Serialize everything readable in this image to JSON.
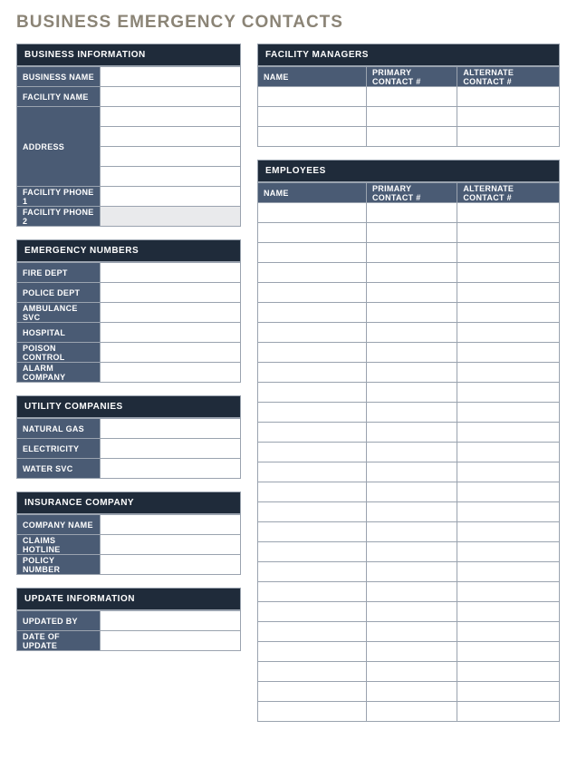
{
  "title": "BUSINESS EMERGENCY CONTACTS",
  "sections": {
    "business_info": {
      "header": "BUSINESS INFORMATION",
      "rows": {
        "business_name": "BUSINESS NAME",
        "facility_name": "FACILITY NAME",
        "address": "ADDRESS",
        "facility_phone1": "FACILITY PHONE 1",
        "facility_phone2": "FACILITY PHONE 2"
      },
      "values": {
        "business_name": "",
        "facility_name": "",
        "address1": "",
        "address2": "",
        "address3": "",
        "address4": "",
        "facility_phone1": "",
        "facility_phone2": ""
      }
    },
    "emergency_numbers": {
      "header": "EMERGENCY NUMBERS",
      "rows": {
        "fire": "FIRE DEPT",
        "police": "POLICE DEPT",
        "ambulance": "AMBULANCE SVC",
        "hospital": "HOSPITAL",
        "poison": "POISON CONTROL",
        "alarm": "ALARM COMPANY"
      },
      "values": {
        "fire": "",
        "police": "",
        "ambulance": "",
        "hospital": "",
        "poison": "",
        "alarm": ""
      }
    },
    "utility": {
      "header": "UTILITY COMPANIES",
      "rows": {
        "gas": "NATURAL GAS",
        "electricity": "ELECTRICITY",
        "water": "WATER SVC"
      },
      "values": {
        "gas": "",
        "electricity": "",
        "water": ""
      }
    },
    "insurance": {
      "header": "INSURANCE COMPANY",
      "rows": {
        "company": "COMPANY NAME",
        "claims": "CLAIMS HOTLINE",
        "policy": "POLICY NUMBER"
      },
      "values": {
        "company": "",
        "claims": "",
        "policy": ""
      }
    },
    "update": {
      "header": "UPDATE INFORMATION",
      "rows": {
        "updated_by": "UPDATED BY",
        "date": "DATE OF UPDATE"
      },
      "values": {
        "updated_by": "",
        "date": ""
      }
    },
    "facility_managers": {
      "header": "FACILITY MANAGERS",
      "cols": {
        "name": "NAME",
        "primary": "PRIMARY CONTACT #",
        "alternate": "ALTERNATE CONTACT #"
      },
      "rows": [
        {
          "name": "",
          "primary": "",
          "alternate": ""
        },
        {
          "name": "",
          "primary": "",
          "alternate": ""
        },
        {
          "name": "",
          "primary": "",
          "alternate": ""
        }
      ]
    },
    "employees": {
      "header": "EMPLOYEES",
      "cols": {
        "name": "NAME",
        "primary": "PRIMARY CONTACT #",
        "alternate": "ALTERNATE CONTACT #"
      },
      "rows": [
        {
          "name": "",
          "primary": "",
          "alternate": ""
        },
        {
          "name": "",
          "primary": "",
          "alternate": ""
        },
        {
          "name": "",
          "primary": "",
          "alternate": ""
        },
        {
          "name": "",
          "primary": "",
          "alternate": ""
        },
        {
          "name": "",
          "primary": "",
          "alternate": ""
        },
        {
          "name": "",
          "primary": "",
          "alternate": ""
        },
        {
          "name": "",
          "primary": "",
          "alternate": ""
        },
        {
          "name": "",
          "primary": "",
          "alternate": ""
        },
        {
          "name": "",
          "primary": "",
          "alternate": ""
        },
        {
          "name": "",
          "primary": "",
          "alternate": ""
        },
        {
          "name": "",
          "primary": "",
          "alternate": ""
        },
        {
          "name": "",
          "primary": "",
          "alternate": ""
        },
        {
          "name": "",
          "primary": "",
          "alternate": ""
        },
        {
          "name": "",
          "primary": "",
          "alternate": ""
        },
        {
          "name": "",
          "primary": "",
          "alternate": ""
        },
        {
          "name": "",
          "primary": "",
          "alternate": ""
        },
        {
          "name": "",
          "primary": "",
          "alternate": ""
        },
        {
          "name": "",
          "primary": "",
          "alternate": ""
        },
        {
          "name": "",
          "primary": "",
          "alternate": ""
        },
        {
          "name": "",
          "primary": "",
          "alternate": ""
        },
        {
          "name": "",
          "primary": "",
          "alternate": ""
        },
        {
          "name": "",
          "primary": "",
          "alternate": ""
        },
        {
          "name": "",
          "primary": "",
          "alternate": ""
        },
        {
          "name": "",
          "primary": "",
          "alternate": ""
        },
        {
          "name": "",
          "primary": "",
          "alternate": ""
        },
        {
          "name": "",
          "primary": "",
          "alternate": ""
        }
      ]
    }
  }
}
